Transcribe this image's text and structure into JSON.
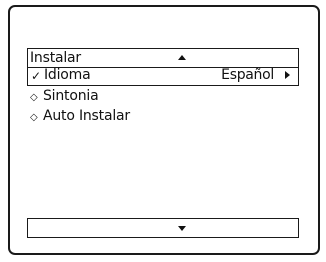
{
  "menu": {
    "title": "Instalar",
    "scroll_up_icon": "triangle-up-icon",
    "scroll_down_icon": "triangle-down-icon",
    "items": [
      {
        "marker": "✓",
        "label": "Idioma",
        "value": "Español",
        "selected": true,
        "submenu_icon": "triangle-right-icon"
      },
      {
        "marker": "◇",
        "label": "Sintonia"
      },
      {
        "marker": "◇",
        "label": "Auto Instalar"
      }
    ]
  },
  "colors": {
    "background": "#ffffff",
    "foreground": "#111111",
    "border": "#1a1a1a"
  }
}
